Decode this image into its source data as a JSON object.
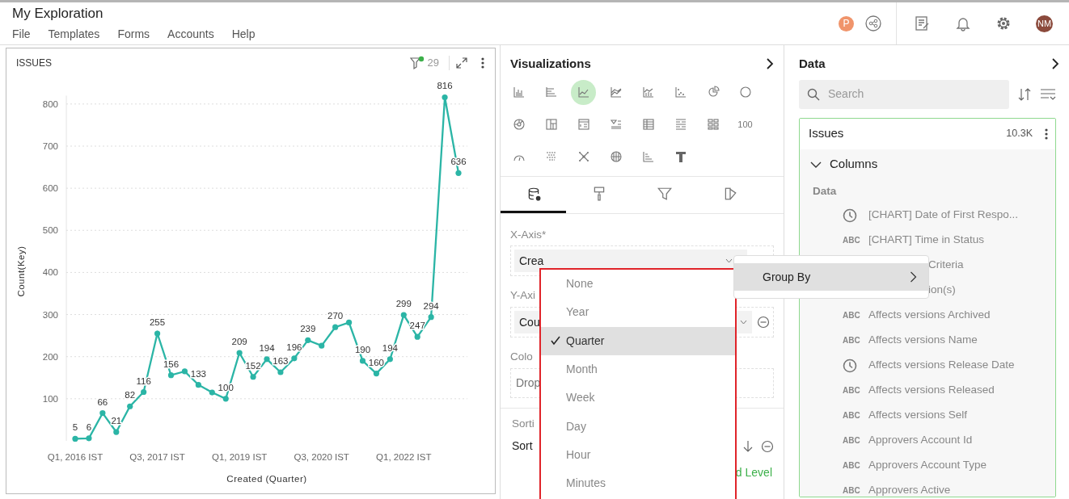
{
  "window": {
    "title": "My Exploration"
  },
  "menu": [
    "File",
    "Templates",
    "Forms",
    "Accounts",
    "Help"
  ],
  "header": {
    "badge": "P",
    "avatar": "NM"
  },
  "chart_panel": {
    "title": "ISSUES",
    "filter_count": "29",
    "filter_active": true,
    "chart_data": {
      "type": "line",
      "xlabel": "Created (Quarter)",
      "ylabel": "Count(Key)",
      "categories": [
        "Q1, 2016 IST",
        null,
        null,
        null,
        null,
        null,
        "Q3, 2017 IST",
        null,
        null,
        null,
        null,
        null,
        "Q1, 2019 IST",
        null,
        null,
        null,
        null,
        null,
        "Q3, 2020 IST",
        null,
        null,
        null,
        null,
        null,
        "Q1, 2022 IST",
        null,
        null,
        null,
        null
      ],
      "series": [
        {
          "color": "#2bb5a6",
          "marker": true,
          "values": [
            5,
            6,
            66,
            21,
            82,
            116,
            255,
            156,
            165,
            133,
            115,
            100,
            209,
            152,
            194,
            163,
            196,
            239,
            226,
            270,
            281,
            190,
            160,
            194,
            299,
            247,
            294,
            816,
            636
          ]
        }
      ],
      "value_labels": [
        "5",
        "6",
        "66",
        "21",
        "82",
        "116",
        "255",
        "156",
        null,
        "133",
        null,
        "100",
        "209",
        "152",
        "194",
        "163",
        "196",
        "239",
        null,
        "270",
        null,
        "190",
        "160",
        "194",
        "299",
        "247",
        "294",
        "816",
        "636"
      ],
      "grid": true,
      "ylim": [
        0,
        820
      ],
      "yticks": [
        100,
        200,
        300,
        400,
        500,
        600,
        700,
        800
      ]
    }
  },
  "visualizations": {
    "title": "Visualizations",
    "items": [
      {
        "selected": false
      },
      {
        "selected": false
      },
      {
        "selected": true
      },
      {
        "selected": false
      },
      {
        "selected": false
      },
      {
        "selected": false
      },
      {
        "selected": false
      },
      {
        "selected": false
      },
      {
        "selected": false
      },
      {
        "selected": false
      },
      {
        "selected": false
      },
      {
        "selected": false
      },
      {
        "selected": false
      },
      {
        "selected": false
      },
      {
        "selected": false
      },
      {
        "selected": false,
        "label": "100"
      },
      {
        "selected": false
      },
      {
        "selected": false
      },
      {
        "selected": false
      },
      {
        "selected": false
      },
      {
        "selected": false
      },
      {
        "selected": false
      }
    ],
    "tabs": [
      {
        "selected": true
      },
      {
        "selected": false
      },
      {
        "selected": false
      },
      {
        "selected": false
      }
    ],
    "x_axis": {
      "label": "X-Axis*",
      "value": "Crea"
    },
    "y_axis": {
      "label": "Y-Axi",
      "value": "Cou"
    },
    "color": {
      "label": "Colo",
      "placeholder": "Drop"
    },
    "sorting": {
      "label": "Sorti",
      "row_label": "Sort",
      "add_link": "d Level"
    }
  },
  "group_menu": {
    "items": [
      {
        "label": "None",
        "selected": false
      },
      {
        "label": "Year",
        "selected": false
      },
      {
        "label": "Quarter",
        "selected": true
      },
      {
        "label": "Month",
        "selected": false
      },
      {
        "label": "Week",
        "selected": false
      },
      {
        "label": "Day",
        "selected": false
      },
      {
        "label": "Hour",
        "selected": false
      },
      {
        "label": "Minutes",
        "selected": false
      }
    ]
  },
  "context_menu": {
    "label": "Group By"
  },
  "data_panel": {
    "title": "Data",
    "search_placeholder": "Search",
    "source": {
      "name": "Issues",
      "count": "10.3K",
      "section": "Columns",
      "expanded": true,
      "group": "Data",
      "columns": [
        {
          "kind": "date",
          "label": "[CHART] Date of First Respo..."
        },
        {
          "kind": "text",
          "type_label": "ABC",
          "label": "[CHART] Time in Status"
        },
        {
          "covered": true,
          "label": "Criteria"
        },
        {
          "covered": true,
          "label": "ion(s)"
        },
        {
          "kind": "text",
          "type_label": "ABC",
          "label": "Affects versions Archived"
        },
        {
          "kind": "text",
          "type_label": "ABC",
          "label": "Affects versions Name"
        },
        {
          "kind": "date",
          "label": "Affects versions Release Date"
        },
        {
          "kind": "text",
          "type_label": "ABC",
          "label": "Affects versions Released"
        },
        {
          "kind": "text",
          "type_label": "ABC",
          "label": "Affects versions Self"
        },
        {
          "kind": "text",
          "type_label": "ABC",
          "label": "Approvers Account Id"
        },
        {
          "kind": "text",
          "type_label": "ABC",
          "label": "Approvers Account Type"
        },
        {
          "kind": "text",
          "type_label": "ABC",
          "label": "Approvers Active"
        }
      ]
    }
  }
}
